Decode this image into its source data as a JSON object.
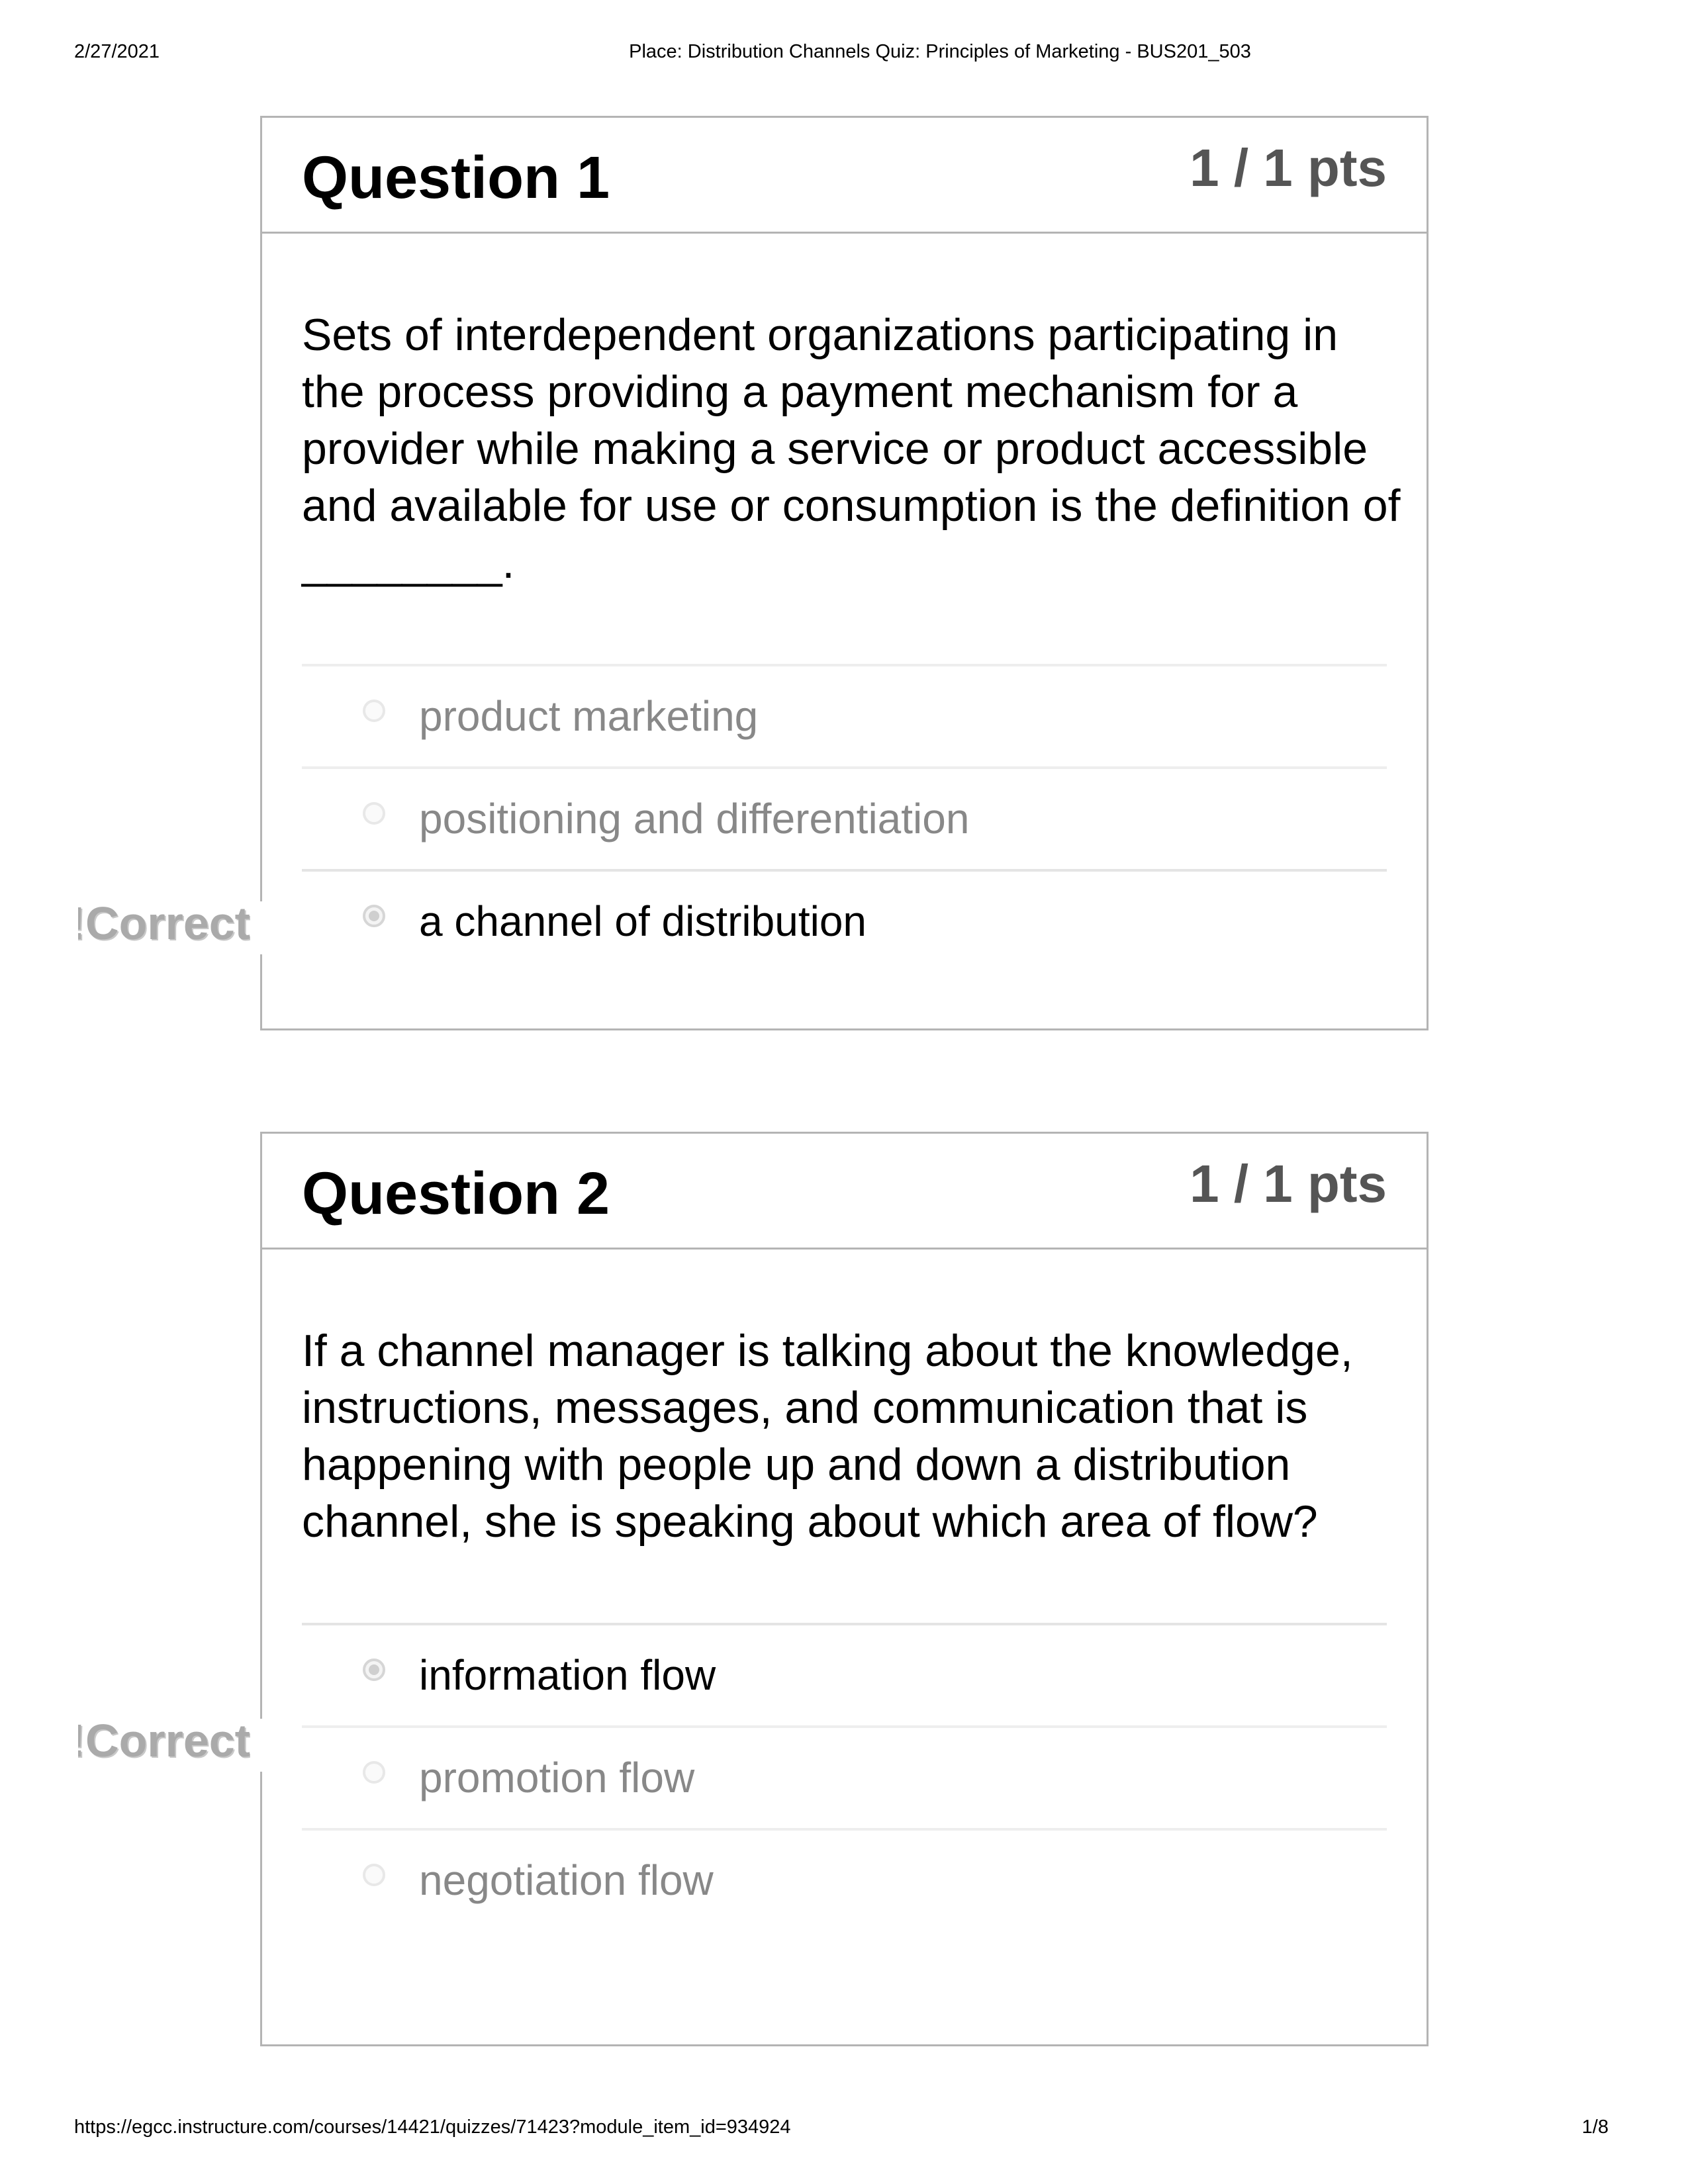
{
  "print_header": {
    "date": "2/27/2021",
    "title": "Place: Distribution Channels Quiz: Principles of Marketing - BUS201_503"
  },
  "questions": [
    {
      "title": "Question 1",
      "points": "1 / 1 pts",
      "text": "Sets of interdependent organizations participating in the process providing a payment mechanism for a provider while making a service or product accessible and available for use or consumption is the definition of ________.",
      "result_label": "Correct!",
      "answers": [
        {
          "label": "product marketing",
          "selected": false
        },
        {
          "label": "positioning and differentiation",
          "selected": false
        },
        {
          "label": "a channel of distribution",
          "selected": true
        }
      ]
    },
    {
      "title": "Question 2",
      "points": "1 / 1 pts",
      "text": "If a channel manager is talking about the knowledge, instructions, messages, and communication that is happening with people up and down a distribution channel, she is speaking about which area of flow?",
      "result_label": "Correct!",
      "answers": [
        {
          "label": "information flow",
          "selected": true
        },
        {
          "label": "promotion flow",
          "selected": false
        },
        {
          "label": "negotiation flow",
          "selected": false
        }
      ]
    }
  ],
  "print_footer": {
    "url": "https://egcc.instructure.com/courses/14421/quizzes/71423?module_item_id=934924",
    "page": "1/8"
  }
}
